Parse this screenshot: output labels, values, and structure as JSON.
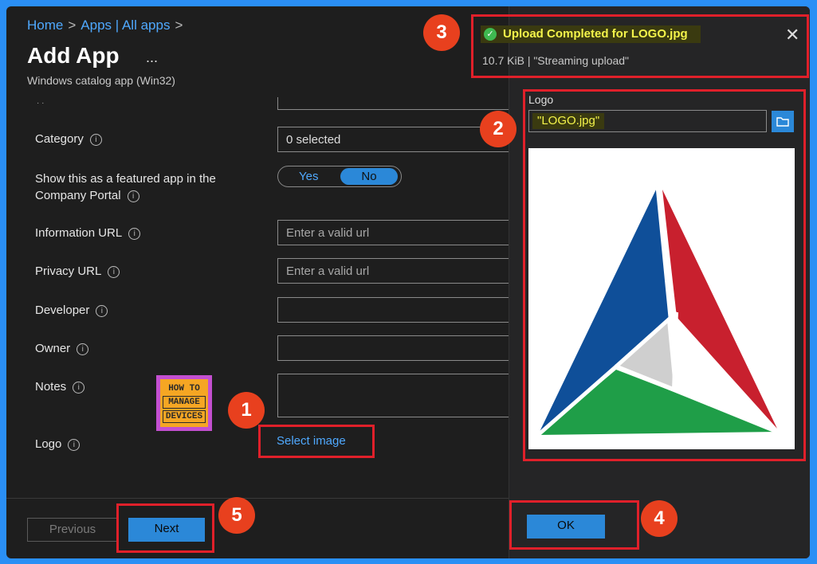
{
  "breadcrumb": {
    "home": "Home",
    "apps": "Apps | All apps"
  },
  "page": {
    "title": "Add App",
    "more": "...",
    "subtitle": "Windows catalog app (Win32)"
  },
  "form": {
    "category_label": "Category",
    "category_value": "0 selected",
    "featured_label_line1": "Show this as a featured app in the",
    "featured_label_line2": "Company Portal",
    "featured_yes": "Yes",
    "featured_no": "No",
    "info_url_label": "Information URL",
    "info_url_placeholder": "Enter a valid url",
    "privacy_url_label": "Privacy URL",
    "privacy_url_placeholder": "Enter a valid url",
    "developer_label": "Developer",
    "owner_label": "Owner",
    "notes_label": "Notes",
    "logo_label": "Logo",
    "select_image": "Select image"
  },
  "watermark": {
    "line1": "HOW TO",
    "line2": "MANAGE",
    "line3": "DEVICES"
  },
  "footer": {
    "previous": "Previous",
    "next": "Next"
  },
  "notification": {
    "title": "Upload Completed for LOGO.jpg",
    "detail": "10.7 KiB | \"Streaming upload\""
  },
  "logo_panel": {
    "label": "Logo",
    "file_name": "\"LOGO.jpg\"",
    "ok": "OK"
  },
  "badges": {
    "b1": "1",
    "b2": "2",
    "b3": "3",
    "b4": "4",
    "b5": "5"
  },
  "colors": {
    "accent": "#2b88d8",
    "highlight": "#e0202a",
    "badge": "#e8401e",
    "success": "#3fb950"
  },
  "icons": {
    "info": "info-icon",
    "folder": "folder-icon",
    "check": "check-circle-icon",
    "close": "close-icon"
  }
}
